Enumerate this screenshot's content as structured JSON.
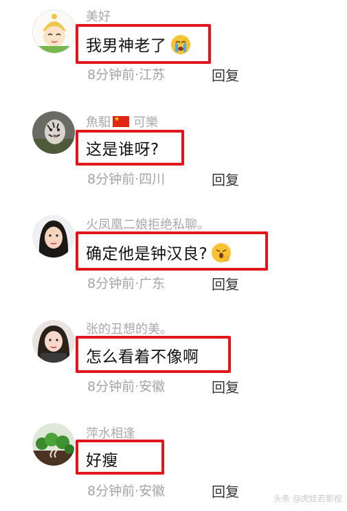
{
  "comments": [
    {
      "username": "美好",
      "text": "我男神老了",
      "emoji": "crying-face-emoji",
      "time": "8分钟前",
      "location": "江苏",
      "reply": "回复"
    },
    {
      "username_prefix": "魚馹",
      "username_flag": "china-flag-icon",
      "username_suffix": "可樂",
      "text": "这是谁呀?",
      "time": "8分钟前",
      "location": "四川",
      "reply": "回复"
    },
    {
      "username": "火凤凰二娘拒绝私聊。",
      "text": "确定他是钟汉良?",
      "emoji": "yawning-face-emoji",
      "time": "8分钟前",
      "location": "广东",
      "reply": "回复"
    },
    {
      "username": "张的丑想的美。",
      "text": "怎么看着不像啊",
      "time": "8分钟前",
      "location": "安徽",
      "reply": "回复"
    },
    {
      "username": "萍水相逢",
      "text": "好瘦",
      "time": "8分钟前",
      "location": "安徽",
      "reply": "回复"
    }
  ],
  "separator": "·",
  "watermark": "头条 @虎娃若影视"
}
